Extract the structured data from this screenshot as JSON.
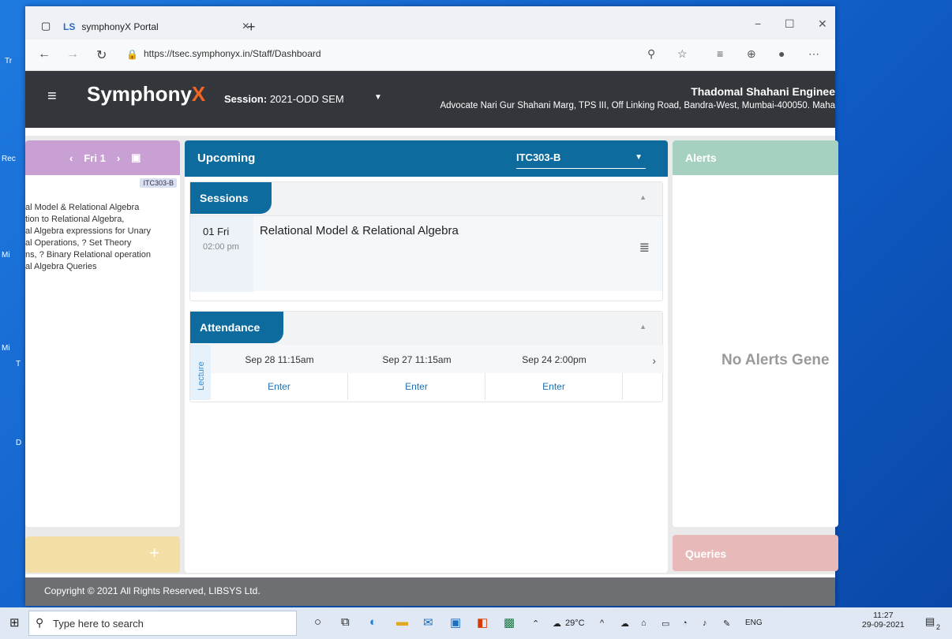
{
  "browser": {
    "tab_title": "symphonyX Portal",
    "tab_logo": "LS",
    "close_tab": "×",
    "new_tab": "+",
    "url": "https://tsec.symphonyx.in/Staff/Dashboard",
    "window_buttons": {
      "minimize": "−",
      "maximize": "☐",
      "close": "✕"
    }
  },
  "app": {
    "brand_prefix": "Symphony",
    "brand_suffix": "X",
    "session_label": "Session:",
    "session_value": "2021-ODD SEM",
    "institution_name": "Thadomal Shahani Enginee",
    "institution_address": "Advocate Nari Gur Shahani Marg, TPS III, Off Linking Road, Bandra-West, Mumbai-400050. Maha"
  },
  "left_panel": {
    "day_label": "Fri 1",
    "badge": "ITC303-B",
    "lines": [
      "al Model & Relational Algebra",
      "tion to Relational Algebra,",
      "al Algebra expressions for Unary",
      "al Operations, ? Set Theory",
      "ns, ? Binary Relational operation",
      "al Algebra Queries"
    ],
    "add_label": "+"
  },
  "upcoming": {
    "title": "Upcoming",
    "subject_select": "ITC303-B",
    "sessions": {
      "title": "Sessions",
      "items": [
        {
          "date": "01 Fri",
          "time": "02:00 pm",
          "title": "Relational Model & Relational Algebra"
        }
      ]
    },
    "attendance": {
      "title": "Attendance",
      "side_label": "Lecture",
      "dates": [
        "Sep 28 11:15am",
        "Sep 27 11:15am",
        "Sep 24 2:00pm"
      ],
      "enter_label": "Enter"
    }
  },
  "alerts": {
    "title": "Alerts",
    "empty_text": "No Alerts Gene"
  },
  "queries": {
    "title": "Queries"
  },
  "footer": {
    "copyright": "Copyright © 2021 All Rights Reserved, LIBSYS Ltd."
  },
  "taskbar": {
    "search_placeholder": "Type here to search",
    "weather": "29°C",
    "language": "ENG",
    "time": "11:27",
    "date": "29-09-2021",
    "notifications": "2"
  },
  "desktop": {
    "labels": [
      "Tr",
      "Rec",
      "Mi",
      "Mi",
      "T",
      "D"
    ]
  }
}
